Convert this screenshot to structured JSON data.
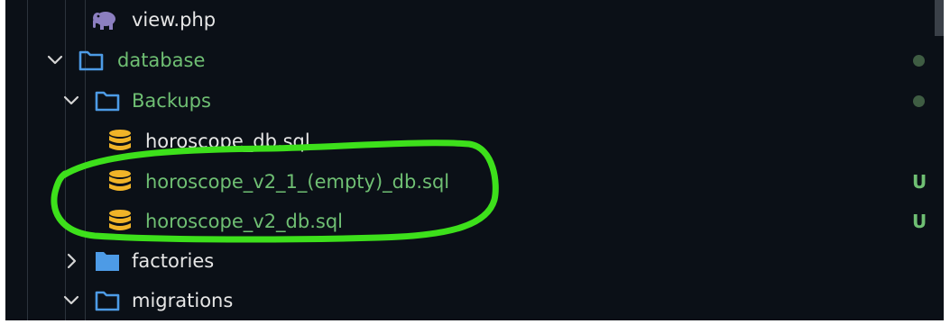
{
  "tree": {
    "items": [
      {
        "label": "view.php",
        "icon": "php-elephant-icon",
        "type": "file",
        "label_color": "#e6e6e6",
        "status": ""
      },
      {
        "label": "database",
        "icon": "folder-open-icon",
        "type": "folder",
        "expanded": true,
        "label_color": "#6fbf73",
        "status": "dot"
      },
      {
        "label": "Backups",
        "icon": "folder-open-icon",
        "type": "folder",
        "expanded": true,
        "label_color": "#6fbf73",
        "status": "dot"
      },
      {
        "label": "horoscope_db.sql",
        "icon": "database-icon",
        "type": "file",
        "label_color": "#e6e6e6",
        "status": ""
      },
      {
        "label": "horoscope_v2_1_(empty)_db.sql",
        "icon": "database-icon",
        "type": "file",
        "label_color": "#6fbf73",
        "status": "U"
      },
      {
        "label": "horoscope_v2_db.sql",
        "icon": "database-icon",
        "type": "file",
        "label_color": "#6fbf73",
        "status": "U"
      },
      {
        "label": "factories",
        "icon": "folder-closed-icon",
        "type": "folder",
        "expanded": false,
        "label_color": "#e6e6e6",
        "status": ""
      },
      {
        "label": "migrations",
        "icon": "folder-open-icon",
        "type": "folder",
        "expanded": true,
        "label_color": "#e6e6e6",
        "status": ""
      }
    ]
  },
  "colors": {
    "background": "#0b1017",
    "untracked_green": "#6fbf73",
    "folder_blue": "#4d9be6",
    "database_icon": "#f0b428",
    "php_icon": "#8c7fc0",
    "highlight_ring": "#3de01b",
    "modified_dot": "#3f5d43"
  }
}
